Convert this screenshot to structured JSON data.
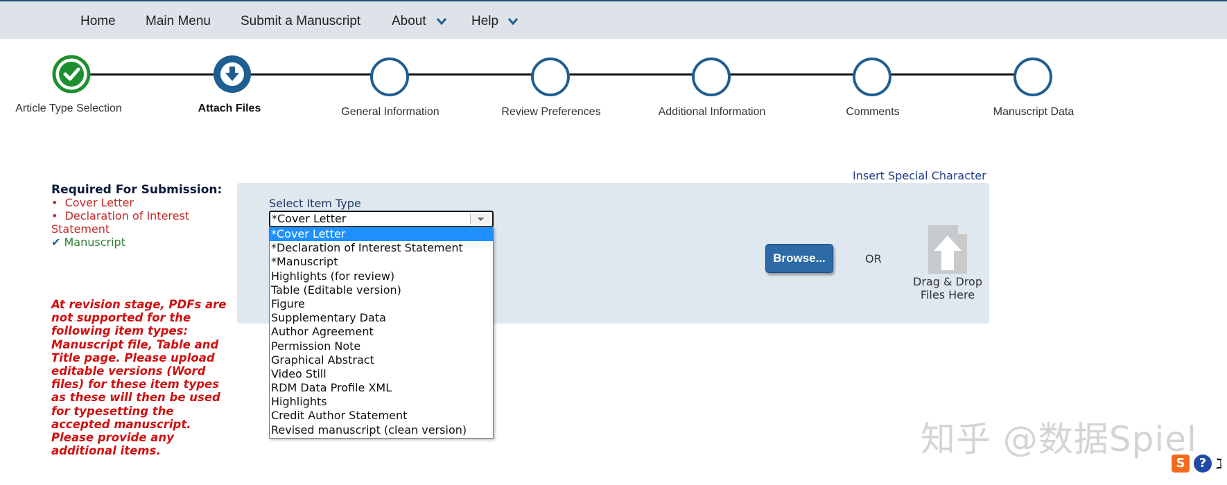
{
  "nav": {
    "home": "Home",
    "main_menu": "Main Menu",
    "submit": "Submit a Manuscript",
    "about": "About",
    "help": "Help"
  },
  "steps": [
    {
      "label": "Article Type Selection",
      "state": "complete"
    },
    {
      "label": "Attach Files",
      "state": "current"
    },
    {
      "label": "General Information",
      "state": "pending"
    },
    {
      "label": "Review Preferences",
      "state": "pending"
    },
    {
      "label": "Additional Information",
      "state": "pending"
    },
    {
      "label": "Comments",
      "state": "pending"
    },
    {
      "label": "Manuscript Data",
      "state": "pending"
    }
  ],
  "requirements": {
    "title": "Required For Submission:",
    "items": [
      "Cover Letter",
      "Declaration of Interest Statement"
    ],
    "done": [
      "Manuscript"
    ]
  },
  "warning": "At revision stage, PDFs are not supported for the following item types: Manuscript file, Table and Title page. Please upload editable versions (Word files) for these item types as these will then be used for typesetting the accepted manuscript. Please provide any additional items.",
  "upload": {
    "special_char_link": "Insert Special Character",
    "select_label": "Select Item Type",
    "selected": "*Cover Letter",
    "options": [
      "*Cover Letter",
      "*Declaration of Interest Statement",
      "*Manuscript",
      "Highlights (for review)",
      "Table (Editable version)",
      "Figure",
      "Supplementary Data",
      "Author Agreement",
      "Permission Note",
      "Graphical Abstract",
      "Video Still",
      "RDM Data Profile XML",
      "Highlights",
      "Credit Author Statement",
      "Revised manuscript (clean version)"
    ],
    "browse_label": "Browse...",
    "or_label": "OR",
    "drag_drop_label": "Drag & Drop Files Here"
  },
  "watermark": "知乎 @数据Spiel",
  "colors": {
    "nav_bg": "#dde3e9",
    "step_blue": "#1f5e91",
    "step_complete": "#1e8f2f",
    "required_red": "#c62828",
    "done_green": "#2e7d32",
    "panel_bg": "#dfe7ef",
    "browse_btn": "#2d6aa8",
    "selected_option": "#1e90ff"
  },
  "corner_icons": [
    "sogou-ime-icon",
    "help-icon"
  ],
  "corner_glyph": "ℷ"
}
